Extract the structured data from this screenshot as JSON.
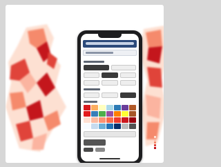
{
  "scene": {
    "description_type": "product-illustration",
    "colors": {
      "background": "#d7d7d7",
      "card": "#ffffff",
      "choropleth_light": "#fde0d2",
      "choropleth_mid": "#f58a6c",
      "choropleth_dark": "#c4161c",
      "phone_frame": "#1d1d1f",
      "app_header": "#2c4a7a"
    }
  },
  "phone": {
    "palette_swatches": [
      "#d7191c",
      "#fdae61",
      "#ffffbf",
      "#abd9e9",
      "#2c7bb6",
      "#6a3d9a",
      "#b15928",
      "#e41a1c",
      "#377eb8",
      "#4daf4a",
      "#984ea3",
      "#ff7f00",
      "#ffff33",
      "#a65628",
      "#fee0d2",
      "#fcbba1",
      "#fc9272",
      "#fb6a4a",
      "#ef3b2c",
      "#cb181d",
      "#99000d",
      "#f7fbff",
      "#c6dbef",
      "#6baed6",
      "#2171b5",
      "#08306b",
      "#bdbdbd",
      "#525252"
    ]
  },
  "legend": {
    "colors": [
      "#fde0d2",
      "#fbb4a0",
      "#f58a6c",
      "#e0443a",
      "#c4161c"
    ]
  }
}
